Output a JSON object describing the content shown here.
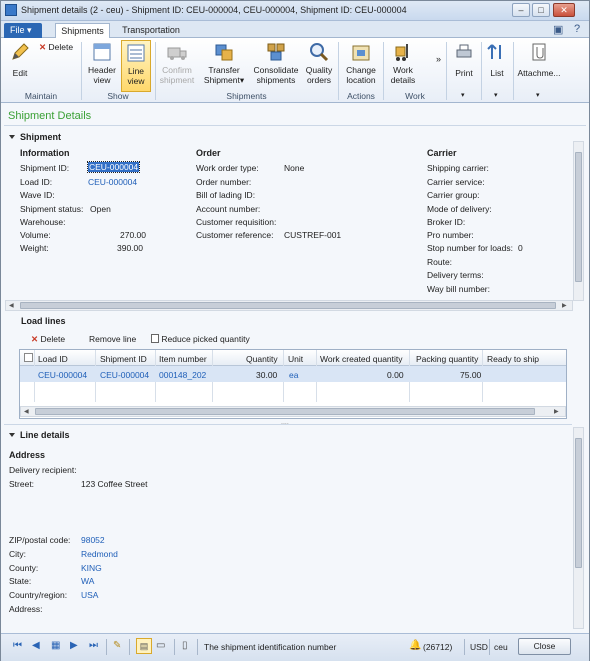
{
  "window": {
    "title": "Shipment details (2 - ceu) - Shipment ID: CEU-000004, CEU-000004, Shipment ID: CEU-000004",
    "controls": {
      "minimize": "–",
      "maximize": "□",
      "close": "✕"
    }
  },
  "ribbon_tabs": {
    "file": "File",
    "shipments": "Shipments",
    "transportation": "Transportation"
  },
  "ribbon": {
    "edit": "Edit",
    "delete": "Delete",
    "maintain": "Maintain",
    "header_view": [
      "Header",
      "view"
    ],
    "line_view": [
      "Line",
      "view"
    ],
    "show": "Show",
    "confirm_shipment": [
      "Confirm",
      "shipment"
    ],
    "transfer_shipment": [
      "Transfer",
      "Shipment▾"
    ],
    "consolidate_shipments": [
      "Consolidate",
      "shipments"
    ],
    "quality_orders": [
      "Quality",
      "orders"
    ],
    "shipments_group": "Shipments",
    "change_location": [
      "Change",
      "location"
    ],
    "actions": "Actions",
    "work_details": [
      "Work",
      "details"
    ],
    "work": "Work",
    "print": "Print",
    "list": "List",
    "attachments": "Attachme..."
  },
  "page_title": "Shipment Details",
  "shipment_section": {
    "header": "Shipment",
    "information": {
      "header": "Information",
      "shipment_id_label": "Shipment ID:",
      "shipment_id": "CEU-000004",
      "load_id_label": "Load ID:",
      "load_id": "CEU-000004",
      "wave_id_label": "Wave ID:",
      "status_label": "Shipment status:",
      "status": "Open",
      "warehouse_label": "Warehouse:",
      "volume_label": "Volume:",
      "volume": "270.00",
      "weight_label": "Weight:",
      "weight": "390.00"
    },
    "order": {
      "header": "Order",
      "work_order_type_label": "Work order type:",
      "work_order_type": "None",
      "order_number_label": "Order number:",
      "bol_label": "Bill of lading ID:",
      "account_label": "Account number:",
      "requisition_label": "Customer requisition:",
      "reference_label": "Customer reference:",
      "reference": "CUSTREF-001"
    },
    "carrier": {
      "header": "Carrier",
      "shipping_carrier": "Shipping carrier:",
      "carrier_service": "Carrier service:",
      "carrier_group": "Carrier group:",
      "mode_of_delivery": "Mode of delivery:",
      "broker_id": "Broker ID:",
      "pro_number": "Pro number:",
      "stop_number_label": "Stop number for loads:",
      "stop_number": "0",
      "route": "Route:",
      "delivery_terms": "Delivery terms:",
      "way_bill": "Way bill number:"
    }
  },
  "load_lines": {
    "header": "Load lines",
    "delete": "Delete",
    "remove_line": "Remove line",
    "reduce_picked": "Reduce picked quantity",
    "columns": [
      "Load ID",
      "Shipment ID",
      "Item number",
      "Quantity",
      "Unit",
      "Work created quantity",
      "Packing quantity",
      "Ready to ship"
    ],
    "rows": [
      {
        "load_id": "CEU-000004",
        "shipment_id": "CEU-000004",
        "item": "000148_202",
        "qty": "30.00",
        "unit": "ea",
        "work_created": "0.00",
        "packing": "75.00",
        "ready": ""
      }
    ]
  },
  "line_details": {
    "header": "Line details",
    "address_header": "Address",
    "recipient_label": "Delivery recipient:",
    "street_label": "Street:",
    "street": "123 Coffee Street",
    "zip_label": "ZIP/postal code:",
    "zip": "98052",
    "city_label": "City:",
    "city": "Redmond",
    "county_label": "County:",
    "county": "KING",
    "state_label": "State:",
    "state": "WA",
    "country_label": "Country/region:",
    "country": "USA",
    "address_label": "Address:"
  },
  "status_bar": {
    "help_text": "The shipment identification number",
    "notifications": "(26712)",
    "currency": "USD",
    "company": "ceu",
    "close": "Close"
  }
}
